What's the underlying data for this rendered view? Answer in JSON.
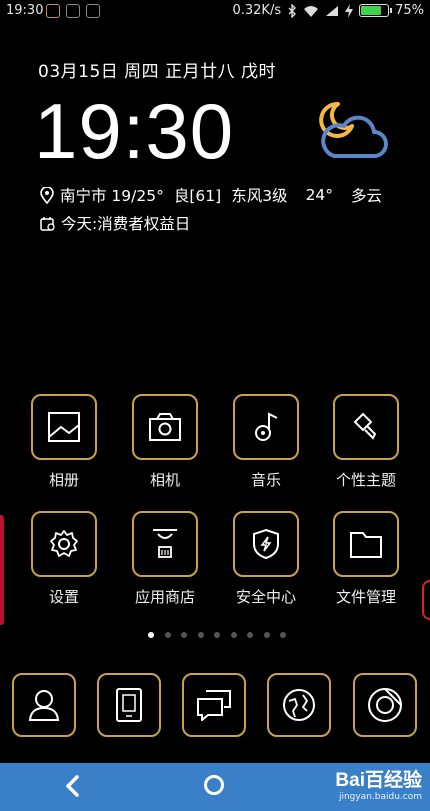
{
  "status_bar": {
    "time": "19:30",
    "network_speed": "0.32K/s",
    "battery": "75%",
    "battery_level": 0.75,
    "icons": [
      "notification-app-icon",
      "notification-wechat-icon",
      "notification-message-icon",
      "bluetooth-icon",
      "wifi-icon",
      "signal-icon",
      "charging-icon",
      "battery-icon"
    ]
  },
  "widget": {
    "date": "03月15日 周四 正月廿八 戊时",
    "clock": "19:30",
    "weather_icon": "moon-cloud-icon",
    "city": "南宁市 19/25°",
    "air": "良[61]",
    "wind": "东风3级",
    "temp": "24°",
    "condition": "多云",
    "today": "今天:消费者权益日"
  },
  "apps": [
    {
      "label": "相册",
      "icon": "gallery-icon"
    },
    {
      "label": "相机",
      "icon": "camera-icon"
    },
    {
      "label": "音乐",
      "icon": "music-icon"
    },
    {
      "label": "个性主题",
      "icon": "theme-brush-icon"
    },
    {
      "label": "设置",
      "icon": "settings-gear-icon"
    },
    {
      "label": "应用商店",
      "icon": "app-store-bag-icon"
    },
    {
      "label": "安全中心",
      "icon": "security-shield-icon"
    },
    {
      "label": "文件管理",
      "icon": "folder-icon"
    }
  ],
  "page_indicator": {
    "count": 9,
    "active": 0
  },
  "dock": [
    "contacts-icon",
    "phone-icon",
    "messages-icon",
    "browser-icon",
    "camera-app-icon"
  ],
  "navbar": {
    "back": "back-icon",
    "home": "home-icon"
  },
  "watermark": {
    "brand": "Bai百经验",
    "url": "jingyan.baidu.com"
  },
  "colors": {
    "accent_gold": "#c9a24a",
    "weather_moon": "#f5b942",
    "weather_cloud": "#5b86c7",
    "navbar": "#3a80c9"
  }
}
